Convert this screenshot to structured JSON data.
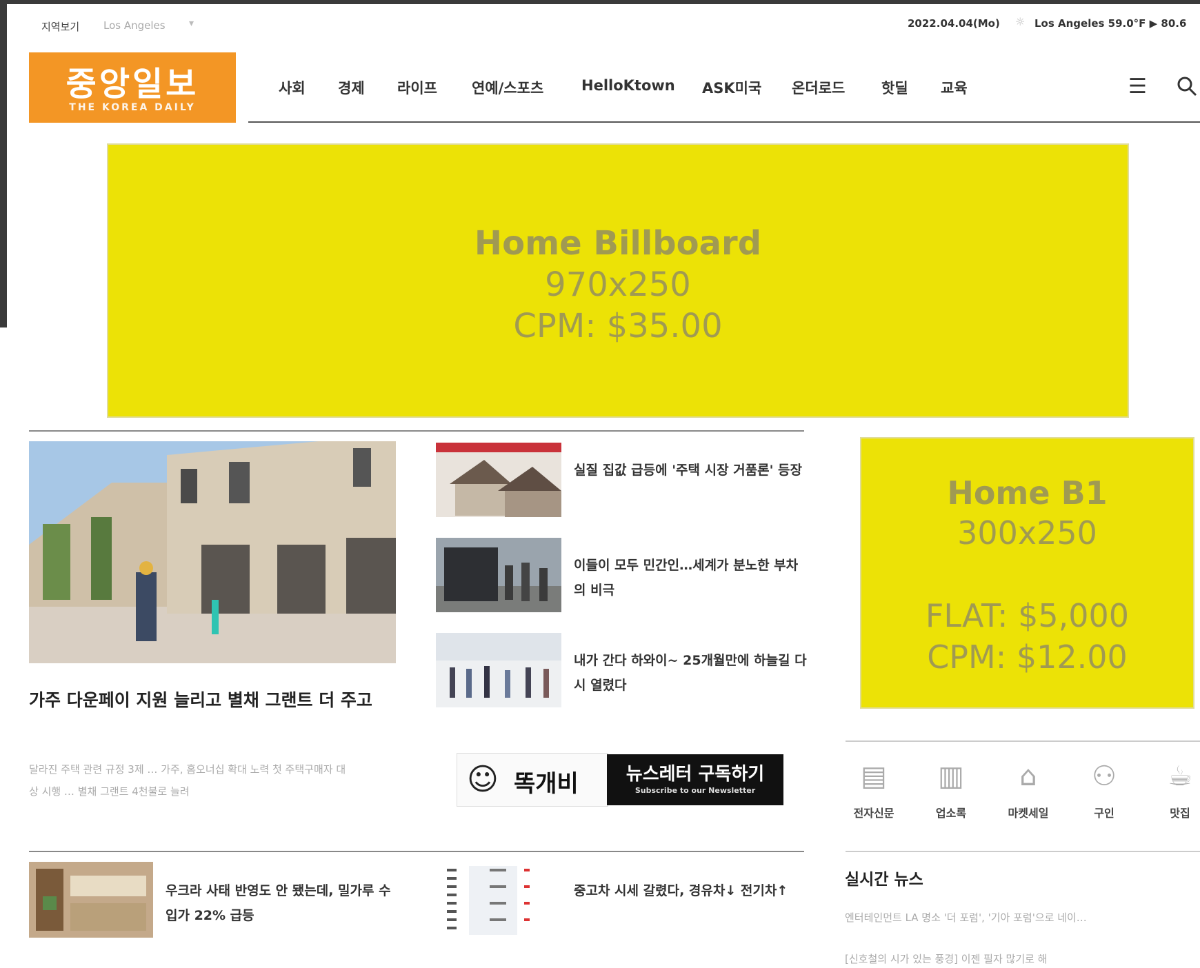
{
  "topbar": {
    "region_label": "지역보기",
    "region_value": "Los Angeles",
    "date": "2022.04.04(Mo)",
    "weather": "Los Angeles 59.0°F ▶ 80.6"
  },
  "logo": {
    "korean": "중앙일보",
    "english": "THE KOREA DAILY"
  },
  "nav": {
    "items": [
      "사회",
      "경제",
      "라이프",
      "연예/스포츠",
      "HelloKtown",
      "ASK미국",
      "온더로드",
      "핫딜",
      "교육"
    ]
  },
  "billboard": {
    "title": "Home Billboard",
    "size": "970x250",
    "price": "CPM: $35.00"
  },
  "featured": {
    "title": "가주 다운페이 지원 늘리고 별채 그랜트 더 주고",
    "desc": "달라진 주택 관련 규정 3제 … 가주, 홈오너십 확대 노력 첫 주택구매자 대상 시행 … 별채 그랜트 4천불로 늘려"
  },
  "side_news": [
    {
      "title": "실질 집값 급등에 '주택 시장 거품론' 등장"
    },
    {
      "title": "이들이 모두 민간인…세계가 분노한 부차의 비극"
    },
    {
      "title": "내가 간다 하와이~ 25개월만에 하늘길 다시 열렸다"
    }
  ],
  "dokkaebi": {
    "label": "똑개비"
  },
  "newsletter": {
    "title": "뉴스레터 구독하기",
    "sub": "Subscribe to our Newsletter"
  },
  "b1": {
    "title": "Home B1",
    "size": "300x250",
    "flat": "FLAT: $5,000",
    "cpm": "CPM: $12.00"
  },
  "services": [
    "전자신문",
    "업소록",
    "마켓세일",
    "구인",
    "맛집"
  ],
  "bottom_news": [
    {
      "title": "우크라 사태 반영도 안 됐는데, 밀가루 수입가 22% 급등"
    },
    {
      "title": "중고차 시세 갈렸다, 경유차↓ 전기차↑"
    }
  ],
  "realtime": {
    "title": "실시간 뉴스",
    "items": [
      "엔터테인먼트 LA 명소 '더 포럼', '기아 포럼'으로 네이…",
      "[신호철의 시가 있는 풍경] 이젠 필자 많기로 해"
    ]
  },
  "colors": {
    "brand": "#f39625",
    "ad_yellow": "#ece206",
    "ad_text": "#a09a52"
  }
}
